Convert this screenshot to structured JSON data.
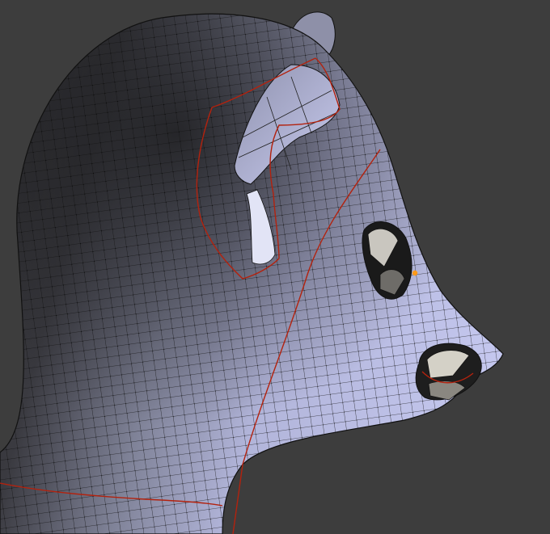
{
  "viewport": {
    "background_color": "#3d3d3d",
    "mesh_face_light_color": "#b8bbe0",
    "mesh_face_dark_color": "#2a2a2c",
    "wire_edge_color": "#111111",
    "seam_edge_color": "#b3220e",
    "selected_vertex_color": "#ff9a1a"
  },
  "object": {
    "name": "",
    "icon": "mesh-object-icon"
  }
}
